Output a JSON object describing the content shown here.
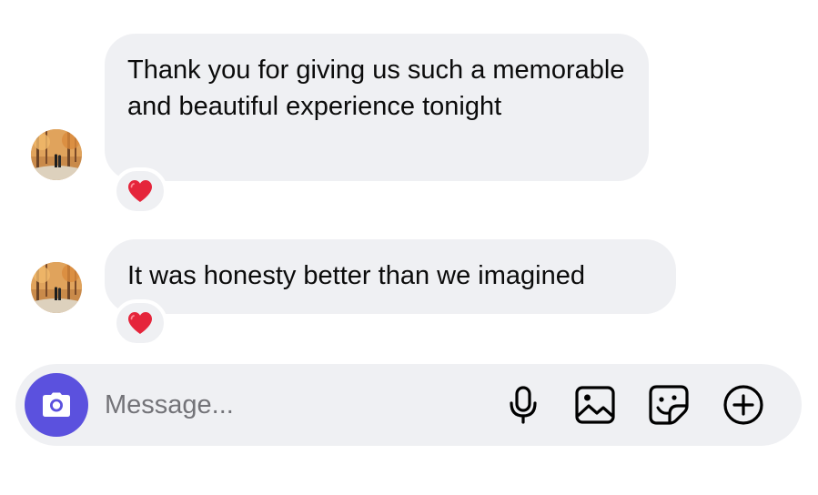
{
  "messages": [
    {
      "text": "Thank you for giving us such a memorable and beautiful experience tonight",
      "reaction": "❤️"
    },
    {
      "text": "It was honesty better than we imagined",
      "reaction": "❤️"
    }
  ],
  "composer": {
    "placeholder": "Message...",
    "icons": [
      "camera-icon",
      "microphone-icon",
      "image-icon",
      "sticker-icon",
      "plus-circle-icon"
    ]
  },
  "colors": {
    "bubble": "#eff0f3",
    "camera_button": "#5b51de",
    "heart": "#e5253b",
    "placeholder": "#737378"
  }
}
